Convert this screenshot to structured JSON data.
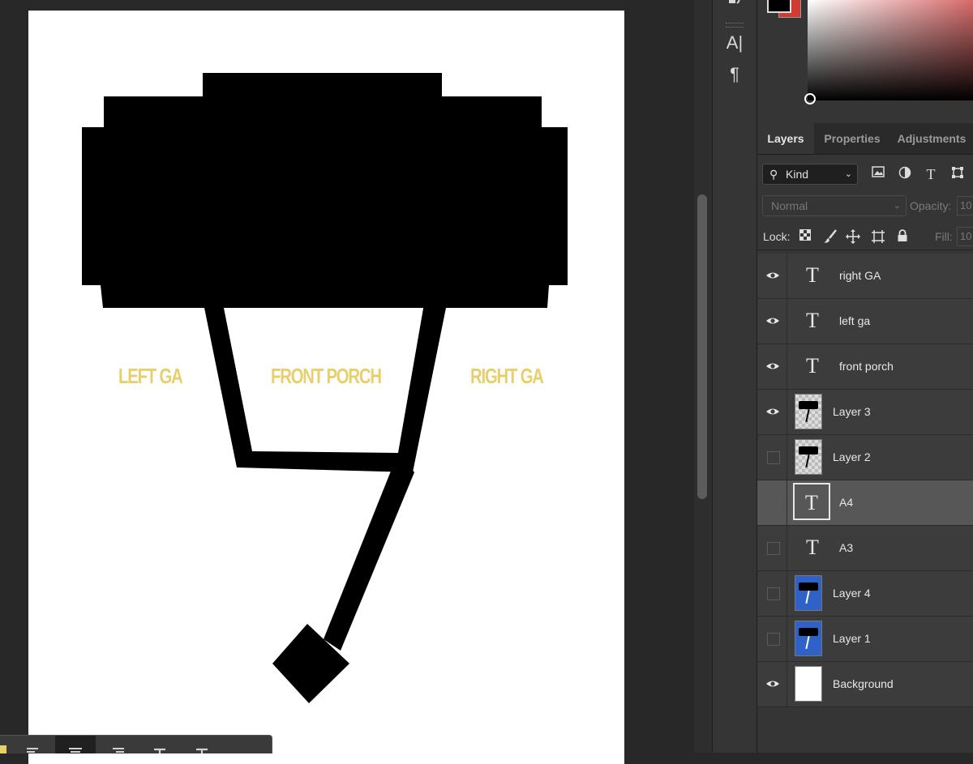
{
  "document": {
    "labels": {
      "left_ga": "LEFT GA",
      "front_porch": "FRONT PORCH",
      "right_ga": "RIGHT GA"
    },
    "label_color": "#e8cf6c"
  },
  "tool_strip": {
    "icons": [
      "character-panel-icon",
      "paragraph-panel-icon"
    ],
    "character_glyph": "A|",
    "paragraph_glyph": "¶"
  },
  "color_panel": {
    "foreground": "#000000",
    "background": "#d23b34"
  },
  "layers_panel": {
    "tabs": [
      {
        "label": "Layers",
        "active": true
      },
      {
        "label": "Properties",
        "active": false
      },
      {
        "label": "Adjustments",
        "active": false
      }
    ],
    "filter": {
      "kind_label": "Kind"
    },
    "blend_mode": "Normal",
    "opacity_label": "Opacity:",
    "opacity_value": "10",
    "lock_label": "Lock:",
    "fill_label": "Fill:",
    "fill_value": "10",
    "layers": [
      {
        "name": "right GA",
        "type": "text",
        "visible": true,
        "selected": false
      },
      {
        "name": "left ga",
        "type": "text",
        "visible": true,
        "selected": false
      },
      {
        "name": "front porch",
        "type": "text",
        "visible": true,
        "selected": false
      },
      {
        "name": "Layer 3",
        "type": "image",
        "visible": true,
        "selected": false
      },
      {
        "name": "Layer 2",
        "type": "image",
        "visible": false,
        "selected": false
      },
      {
        "name": "A4",
        "type": "text",
        "visible": false,
        "selected": true
      },
      {
        "name": "A3",
        "type": "text",
        "visible": false,
        "selected": false
      },
      {
        "name": "Layer 4",
        "type": "image",
        "visible": false,
        "selected": false
      },
      {
        "name": "Layer 1",
        "type": "image",
        "visible": false,
        "selected": false
      },
      {
        "name": "Background",
        "type": "background",
        "visible": true,
        "selected": false
      }
    ]
  },
  "options_bar": {
    "buttons": [
      "left-align-text",
      "center-text",
      "right-align-text",
      "warp-text",
      "toggle-text-orientation"
    ]
  }
}
